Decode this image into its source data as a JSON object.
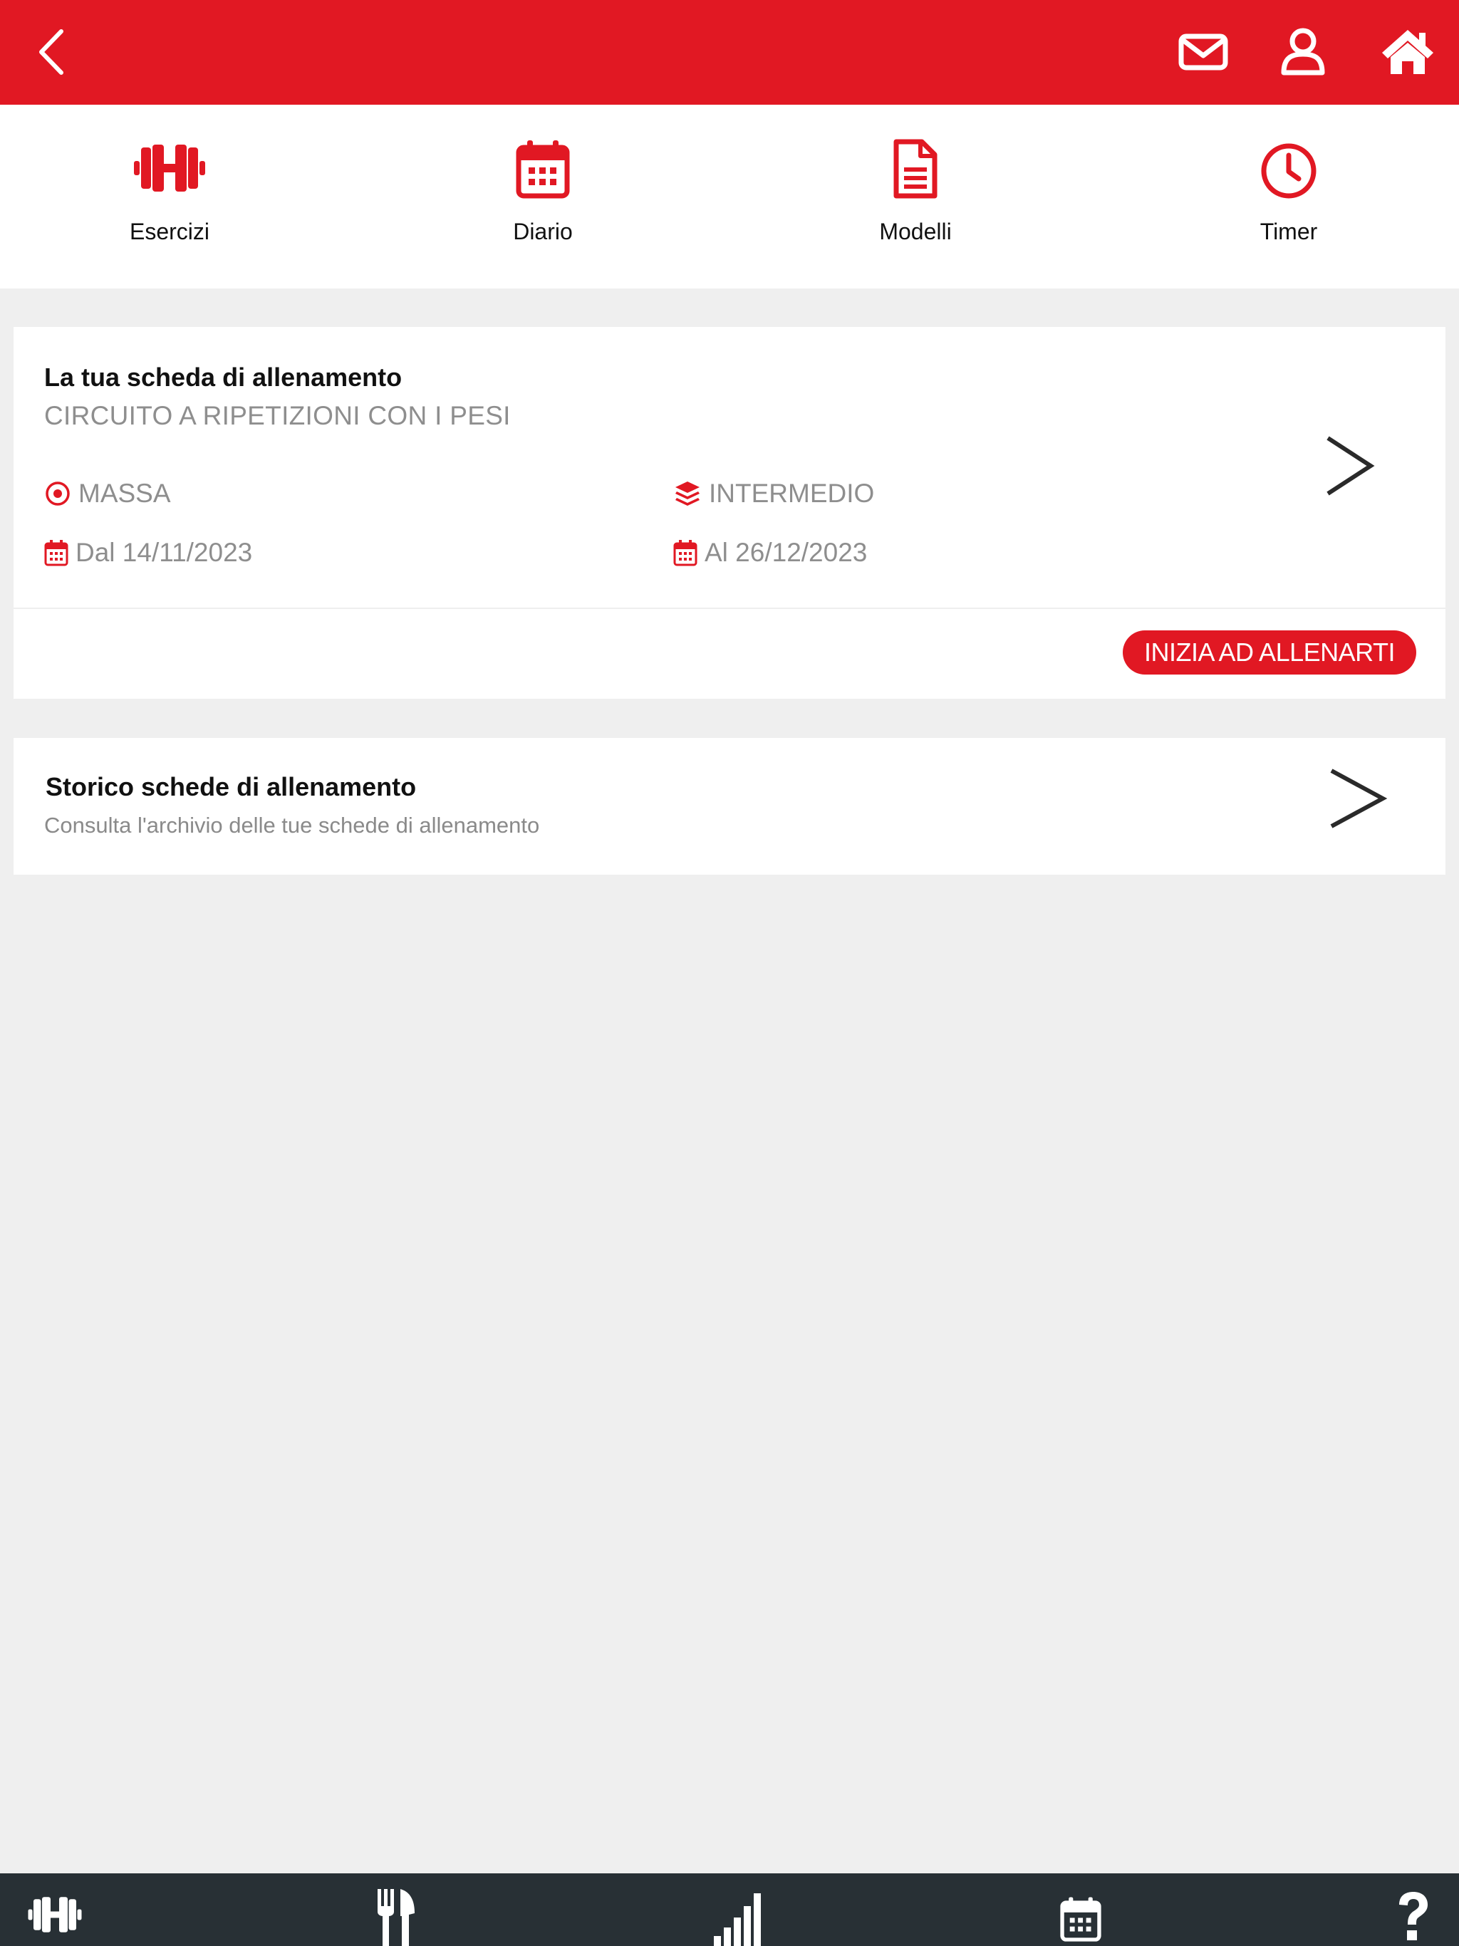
{
  "topbar": {
    "back_icon": "chevron-left-icon",
    "icons": [
      "envelope-icon",
      "user-icon",
      "home-icon"
    ]
  },
  "quicknav": {
    "items": [
      {
        "label": "Esercizi",
        "icon": "dumbbell-icon"
      },
      {
        "label": "Diario",
        "icon": "calendar-icon"
      },
      {
        "label": "Modelli",
        "icon": "document-icon"
      },
      {
        "label": "Timer",
        "icon": "clock-icon"
      }
    ]
  },
  "current_plan": {
    "title": "La tua scheda di allenamento",
    "name": "CIRCUITO A RIPETIZIONI CON I PESI",
    "goal": "MASSA",
    "level": "INTERMEDIO",
    "start": "Dal 14/11/2023",
    "end": "Al 26/12/2023",
    "cta": "INIZIA AD ALLENARTI"
  },
  "history": {
    "title": "Storico schede di allenamento",
    "subtitle": "Consulta l'archivio delle tue schede di allenamento"
  },
  "bottombar": {
    "icons": [
      "dumbbell-icon",
      "cutlery-icon",
      "signal-bars-icon",
      "calendar-icon",
      "question-icon"
    ]
  },
  "colors": {
    "accent": "#e11823",
    "bottombar": "#283035",
    "background": "#efefef"
  }
}
